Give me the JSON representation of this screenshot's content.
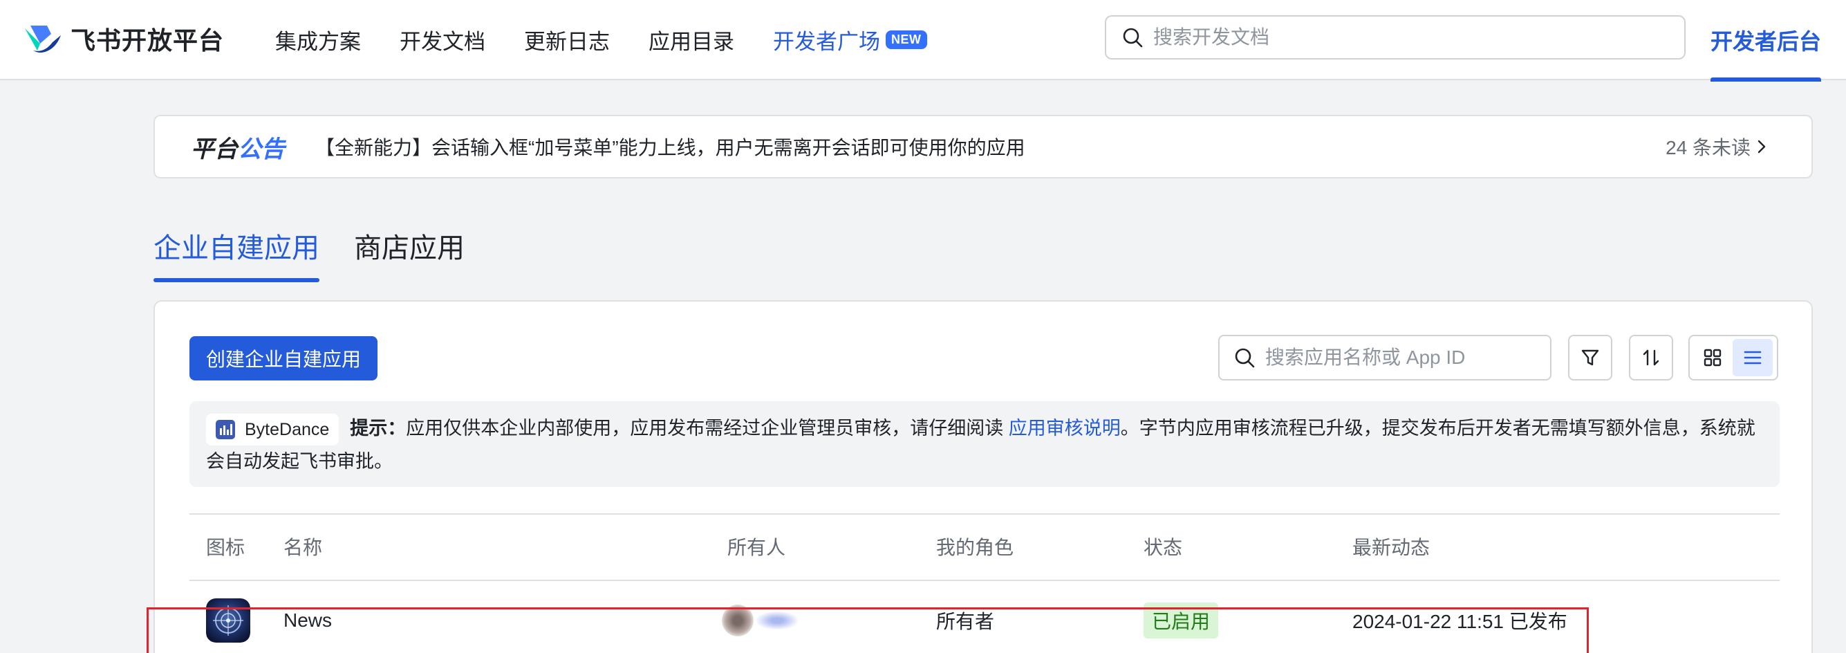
{
  "header": {
    "brand": "飞书开放平台",
    "nav": [
      {
        "label": "集成方案"
      },
      {
        "label": "开发文档"
      },
      {
        "label": "更新日志"
      },
      {
        "label": "应用目录"
      },
      {
        "label": "开发者广场",
        "badge": "NEW",
        "active": true
      }
    ],
    "search_placeholder": "搜索开发文档",
    "console_label": "开发者后台"
  },
  "announcement": {
    "label_part1": "平台",
    "label_part2": "公告",
    "text": "【全新能力】会话输入框“加号菜单”能力上线，用户无需离开会话即可使用你的应用",
    "unread": "24 条未读"
  },
  "tabs": [
    {
      "label": "企业自建应用",
      "active": true
    },
    {
      "label": "商店应用",
      "active": false
    }
  ],
  "toolbar": {
    "create_label": "创建企业自建应用",
    "search_placeholder": "搜索应用名称或 App ID"
  },
  "tip": {
    "org": "ByteDance",
    "label": "提示：",
    "text_before": "应用仅供本企业内部使用，应用发布需经过企业管理员审核，请仔细阅读 ",
    "link": "应用审核说明",
    "text_after": "。字节内应用审核流程已升级，提交发布后开发者无需填写额外信息，系统就会自动发起飞书审批。"
  },
  "table": {
    "columns": [
      "图标",
      "名称",
      "所有人",
      "我的角色",
      "状态",
      "最新动态"
    ],
    "rows": [
      {
        "icon": "news-app-icon",
        "name": "News",
        "owner": "",
        "role": "所有者",
        "status": "已启用",
        "activity": "2024-01-22 11:51 已发布"
      }
    ]
  },
  "colors": {
    "accent": "#245bdb",
    "highlight": "#e0242b",
    "status_bg": "#d9f5d6",
    "status_text": "#237b19"
  }
}
